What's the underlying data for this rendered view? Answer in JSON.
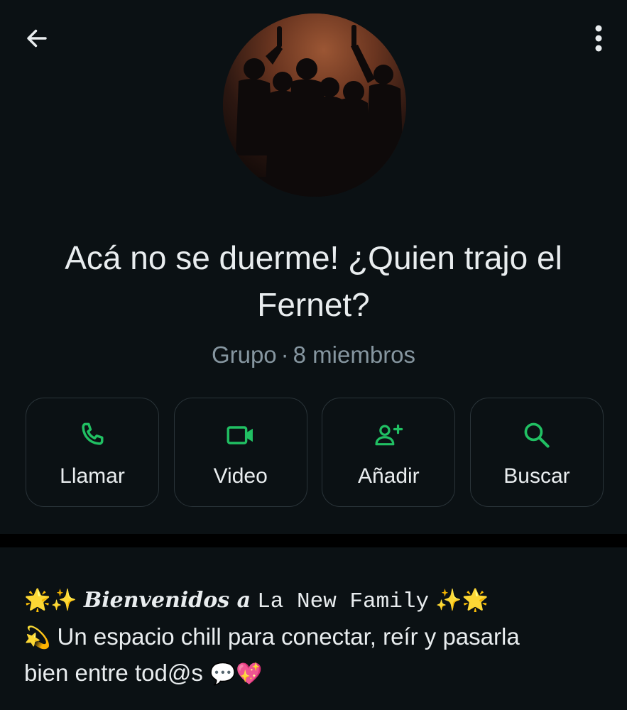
{
  "header": {
    "back_icon": "arrow-left-icon",
    "menu_icon": "more-vertical-icon"
  },
  "group": {
    "title": "Acá no se duerme! ¿Quien trajo el Fernet?",
    "type": "Grupo",
    "separator": "·",
    "members": "8 miembros"
  },
  "actions": [
    {
      "label": "Llamar",
      "icon": "phone-icon"
    },
    {
      "label": "Video",
      "icon": "video-icon"
    },
    {
      "label": "Añadir",
      "icon": "add-person-icon"
    },
    {
      "label": "Buscar",
      "icon": "search-icon"
    }
  ],
  "description": {
    "line1_emoji_start": "🌟✨",
    "line1_welcome": "Bienvenidos a",
    "line1_name": "La New Family",
    "line1_emoji_end": "✨🌟",
    "line2_emoji": "💫",
    "line2_text": "Un espacio chill para conectar, reír y pasarla",
    "line3_text": "bien entre tod@s",
    "line3_emoji": "💬💖"
  },
  "colors": {
    "background": "#0b1114",
    "accent": "#21c063",
    "text_primary": "#e9edef",
    "text_secondary": "#8696a0",
    "button_border": "#2a3439"
  }
}
